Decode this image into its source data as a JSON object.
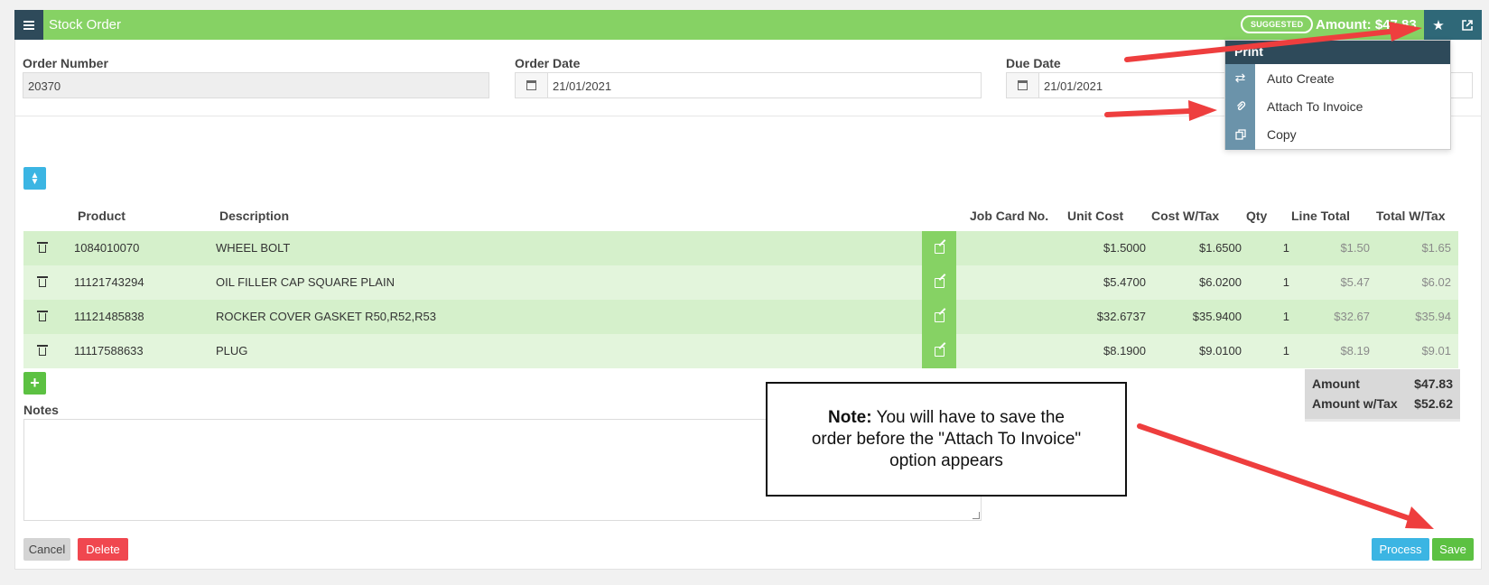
{
  "header": {
    "title": "Stock Order",
    "badge": "SUGGESTED",
    "amount": "Amount: $47.83"
  },
  "form": {
    "order_number": {
      "label": "Order Number",
      "value": "20370"
    },
    "order_date": {
      "label": "Order Date",
      "value": "21/01/2021"
    },
    "due_date": {
      "label": "Due Date",
      "value": "21/01/2021"
    }
  },
  "dropdown": {
    "header": "Print",
    "items": [
      {
        "label": "Auto Create",
        "icon": "exchange-icon"
      },
      {
        "label": "Attach To Invoice",
        "icon": "paperclip-icon"
      },
      {
        "label": "Copy",
        "icon": "copy-icon"
      }
    ]
  },
  "table": {
    "columns": [
      "Product",
      "Description",
      "Job Card No.",
      "Unit Cost",
      "Cost W/Tax",
      "Qty",
      "Line Total",
      "Total W/Tax"
    ],
    "rows": [
      {
        "product": "1084010070",
        "description": "WHEEL BOLT",
        "job_card": "",
        "unit_cost": "$1.5000",
        "cost_tax": "$1.6500",
        "qty": "1",
        "line_total": "$1.50",
        "total_tax": "$1.65"
      },
      {
        "product": "11121743294",
        "description": "OIL FILLER CAP SQUARE PLAIN",
        "job_card": "",
        "unit_cost": "$5.4700",
        "cost_tax": "$6.0200",
        "qty": "1",
        "line_total": "$5.47",
        "total_tax": "$6.02"
      },
      {
        "product": "11121485838",
        "description": "ROCKER COVER GASKET R50,R52,R53",
        "job_card": "",
        "unit_cost": "$32.6737",
        "cost_tax": "$35.9400",
        "qty": "1",
        "line_total": "$32.67",
        "total_tax": "$35.94"
      },
      {
        "product": "11117588633",
        "description": "PLUG",
        "job_card": "",
        "unit_cost": "$8.1900",
        "cost_tax": "$9.0100",
        "qty": "1",
        "line_total": "$8.19",
        "total_tax": "$9.01"
      }
    ]
  },
  "totals": {
    "amount_label": "Amount",
    "amount": "$47.83",
    "amount_tax_label": "Amount w/Tax",
    "amount_tax": "$52.62"
  },
  "notes": {
    "label": "Notes",
    "value": ""
  },
  "buttons": {
    "cancel": "Cancel",
    "delete": "Delete",
    "process": "Process",
    "save": "Save"
  },
  "annotation": {
    "note_bold": "Note:",
    "note_text": " You will have to save the order before the \"Attach To Invoice\" option appears"
  },
  "colors": {
    "header_green": "#86d264",
    "dark_navy": "#2e4a5a",
    "teal": "#2f6878",
    "row_dark": "#d5f0cb",
    "row_light": "#e3f5dc",
    "arrow_red": "#ee3e3e",
    "process_blue": "#3bb5e3",
    "save_green": "#5cc142",
    "delete_red": "#f0474f"
  }
}
